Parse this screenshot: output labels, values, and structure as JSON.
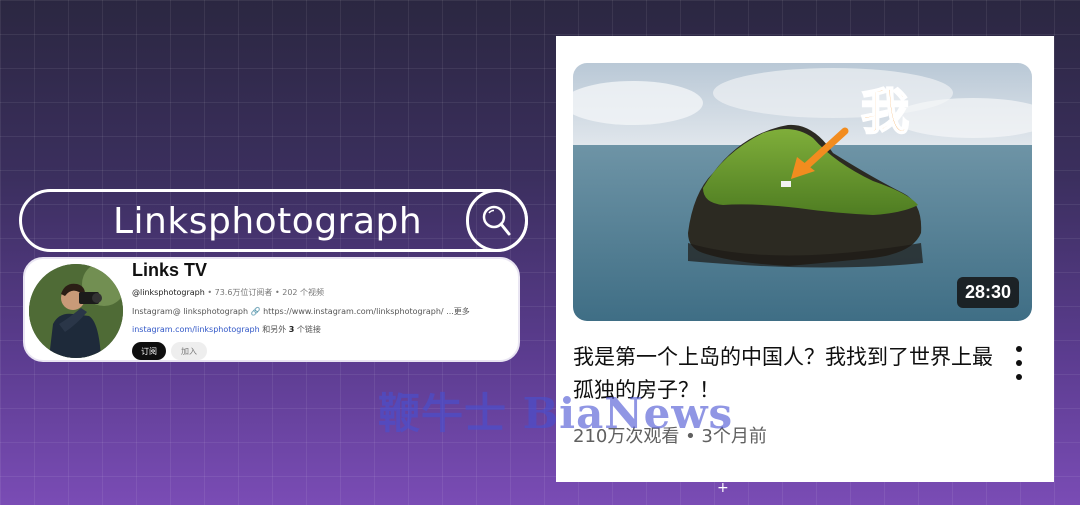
{
  "search": {
    "query": "Linksphotograph",
    "icon": "search-icon"
  },
  "channel": {
    "name": "Links TV",
    "handle": "@linksphotograph",
    "stats": " • 73.6万位订阅者 • 202 个视频",
    "description": "Instagram@ linksphotograph  🔗 https://www.instagram.com/linksphotograph/ ...更多",
    "link_url": "instagram.com/linksphotograph",
    "link_suffix_prefix": " 和另外 ",
    "link_count": "3",
    "link_suffix": " 个链接",
    "subscribe_label": "订阅",
    "join_label": "加入"
  },
  "video": {
    "duration": "28:30",
    "overlay_text": "我",
    "title": "我是第一个上岛的中国人？我找到了世界上最孤独的房子？！",
    "views": "210万次观看",
    "separator": " • ",
    "age": "3个月前"
  },
  "watermark": "鞭牛士 BiaNews",
  "colors": {
    "accent_orange": "#f28c1f",
    "subscribe_bg": "#0f0f0f",
    "link_blue": "#3157c7"
  }
}
